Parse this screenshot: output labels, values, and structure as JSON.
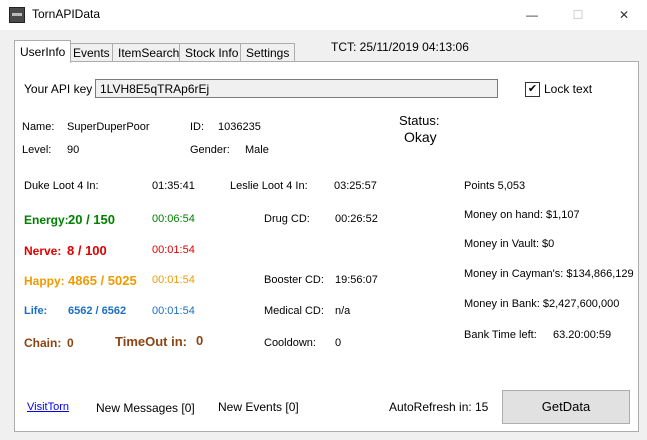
{
  "window": {
    "title": "TornAPIData",
    "minimize": "—",
    "maximize": "☐",
    "close": "✕"
  },
  "tabs": [
    "UserInfo",
    "Events",
    "ItemSearch",
    "Stock Info",
    "Settings"
  ],
  "tct": "TCT: 25/11/2019 04:13:06",
  "api": {
    "label": "Your API key",
    "value": "1LVH8E5qTRAp6rEj"
  },
  "lock": {
    "label": "Lock text",
    "checked": "✔"
  },
  "user": {
    "name_label": "Name:",
    "name": "SuperDuperPoor",
    "id_label": "ID:",
    "id": "1036235",
    "level_label": "Level:",
    "level": "90",
    "gender_label": "Gender:",
    "gender": "Male",
    "status_label": "Status:",
    "status": "Okay"
  },
  "loot": {
    "duke_label": "Duke Loot 4 In:",
    "duke": "01:35:41",
    "leslie_label": "Leslie Loot 4 In:",
    "leslie": "03:25:57"
  },
  "bars": {
    "energy_label": "Energy:",
    "energy": "20 / 150",
    "energy_time": "00:06:54",
    "nerve_label": "Nerve:",
    "nerve": "8 / 100",
    "nerve_time": "00:01:54",
    "happy_label": "Happy:",
    "happy": "4865 / 5025",
    "happy_time": "00:01:54",
    "life_label": "Life:",
    "life": "6562 / 6562",
    "life_time": "00:01:54",
    "chain_label": "Chain:",
    "chain": "0",
    "timeout_label": "TimeOut in:",
    "timeout": "0"
  },
  "cooldowns": {
    "drug_label": "Drug CD:",
    "drug": "00:26:52",
    "booster_label": "Booster CD:",
    "booster": "19:56:07",
    "medical_label": "Medical CD:",
    "medical": "n/a",
    "cooldown_label": "Cooldown:",
    "cooldown": "0"
  },
  "money": {
    "points": "Points 5,053",
    "on_hand": "Money on hand: $1,107",
    "vault": "Money in Vault: $0",
    "cayman": "Money in Cayman's: $134,866,129",
    "bank": "Money in Bank: $2,427,600,000",
    "bank_time_label": "Bank Time left:",
    "bank_time": "63.20:00:59"
  },
  "footer": {
    "visit": "VisitTorn",
    "messages": "New Messages [0]",
    "events": "New Events [0]",
    "autorefresh_label": "AutoRefresh in:",
    "autorefresh": "15",
    "getdata": "GetData"
  },
  "colors": {
    "energy": "#008000",
    "nerve": "#e00000",
    "happy": "#f09a00",
    "life": "#1a6fc4",
    "chain": "#8b4513"
  }
}
